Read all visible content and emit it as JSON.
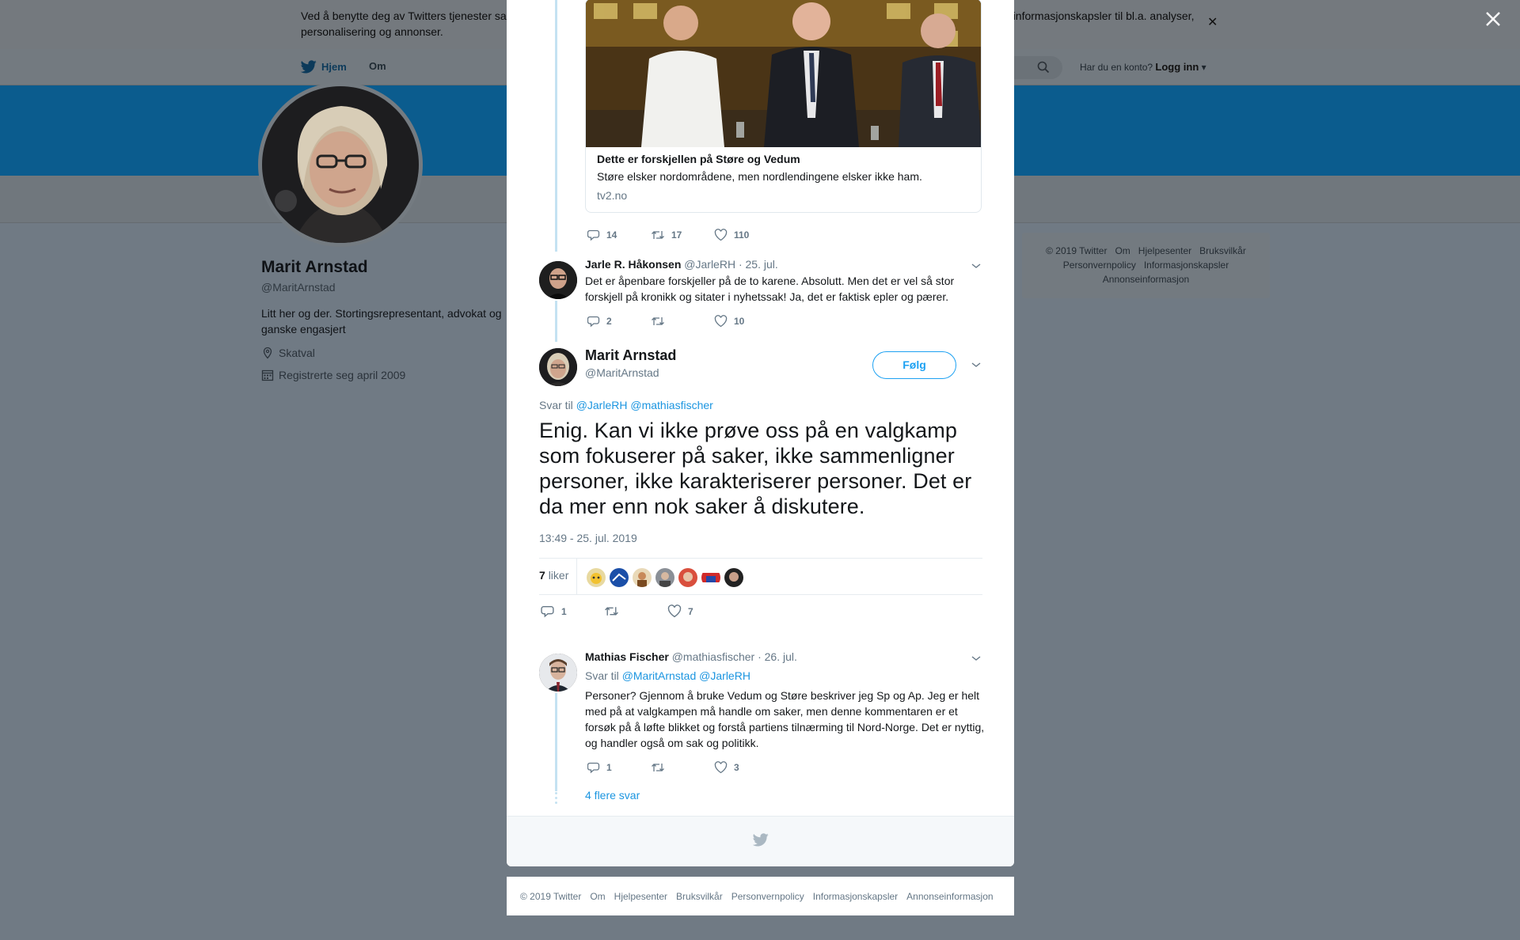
{
  "background": {
    "cookie_notice": "Ved å benytte deg av Twitters tjenester sa … informasjonskapsler til bl.a. analyser, personalisering og annonser.",
    "cookie_notice_left": "Ved å benytte deg av Twitters tjenester sa",
    "cookie_notice_right": "informasjonskapsler til bl.a. analyser,",
    "cookie_notice_line2": "personalisering og annonser.",
    "nav": {
      "home": "Hjem",
      "about": "Om",
      "have_account": "Har du en konto?",
      "login": "Logg inn"
    },
    "profile": {
      "name": "Marit Arnstad",
      "handle": "@MaritArnstad",
      "bio": "Litt her og der. Stortingsrepresentant, advokat og ganske engasjert",
      "location": "Skatval",
      "joined": "Registrerte seg april 2009"
    },
    "side_footer": {
      "line1": [
        "© 2019 Twitter",
        "Om",
        "Hjelpesenter",
        "Bruksvilkår"
      ],
      "line2": [
        "Personvernpolicy",
        "Informasjonskapsler"
      ],
      "line3": [
        "Annonseinformasjon"
      ]
    }
  },
  "card": {
    "title": "Dette er forskjellen på Støre og Vedum",
    "description": "Støre elsker nordområdene, men nordlendingene elsker ikke ham.",
    "url": "tv2.no"
  },
  "quoted_tweet_actions": {
    "replies": "14",
    "retweets": "17",
    "likes": "110"
  },
  "reply1": {
    "name": "Jarle R. Håkonsen",
    "handle": "@JarleRH",
    "date": "· 25. jul.",
    "text": "Det er åpenbare forskjeller på de to karene. Absolutt. Men det er vel så stor forskjell  på kronikk og sitater i nyhetssak! Ja, det er faktisk epler og pærer.",
    "replies": "2",
    "retweets": "",
    "likes": "10"
  },
  "main_tweet": {
    "name": "Marit Arnstad",
    "handle": "@MaritArnstad",
    "follow": "Følg",
    "reply_to_label": "Svar til",
    "reply_to_1": "@JarleRH",
    "reply_to_2": "@mathiasfischer",
    "text": "Enig. Kan vi ikke prøve oss på en valgkamp som fokuserer på saker, ikke sammenligner personer, ikke karakteriserer personer. Det er da mer enn nok saker å diskutere.",
    "timestamp": "13:49 - 25. jul. 2019",
    "likes_count": "7",
    "likes_label": "liker",
    "replies": "1",
    "retweets": "",
    "likes": "7"
  },
  "reply2": {
    "name": "Mathias Fischer",
    "handle": "@mathiasfischer",
    "date": "· 26. jul.",
    "reply_to_label": "Svar til",
    "reply_to_1": "@MaritArnstad",
    "reply_to_2": "@JarleRH",
    "text": "Personer? Gjennom å bruke Vedum og Støre beskriver jeg Sp og Ap. Jeg er helt med på at valgkampen må handle om saker, men denne kommentaren er et forsøk på å løfte blikket og forstå partiens tilnærming til Nord-Norge. Det er nyttig, og handler også om sak og politikk.",
    "replies": "1",
    "retweets": "",
    "likes": "3"
  },
  "more_replies": "4 flere svar",
  "bottom_footer": [
    "© 2019 Twitter",
    "Om",
    "Hjelpesenter",
    "Bruksvilkår",
    "Personvernpolicy",
    "Informasjonskapsler",
    "Annonseinformasjon"
  ],
  "colors": {
    "accent": "#1da1f2",
    "link": "#1b95e0",
    "muted": "#657786",
    "overlay": "#707a84"
  }
}
